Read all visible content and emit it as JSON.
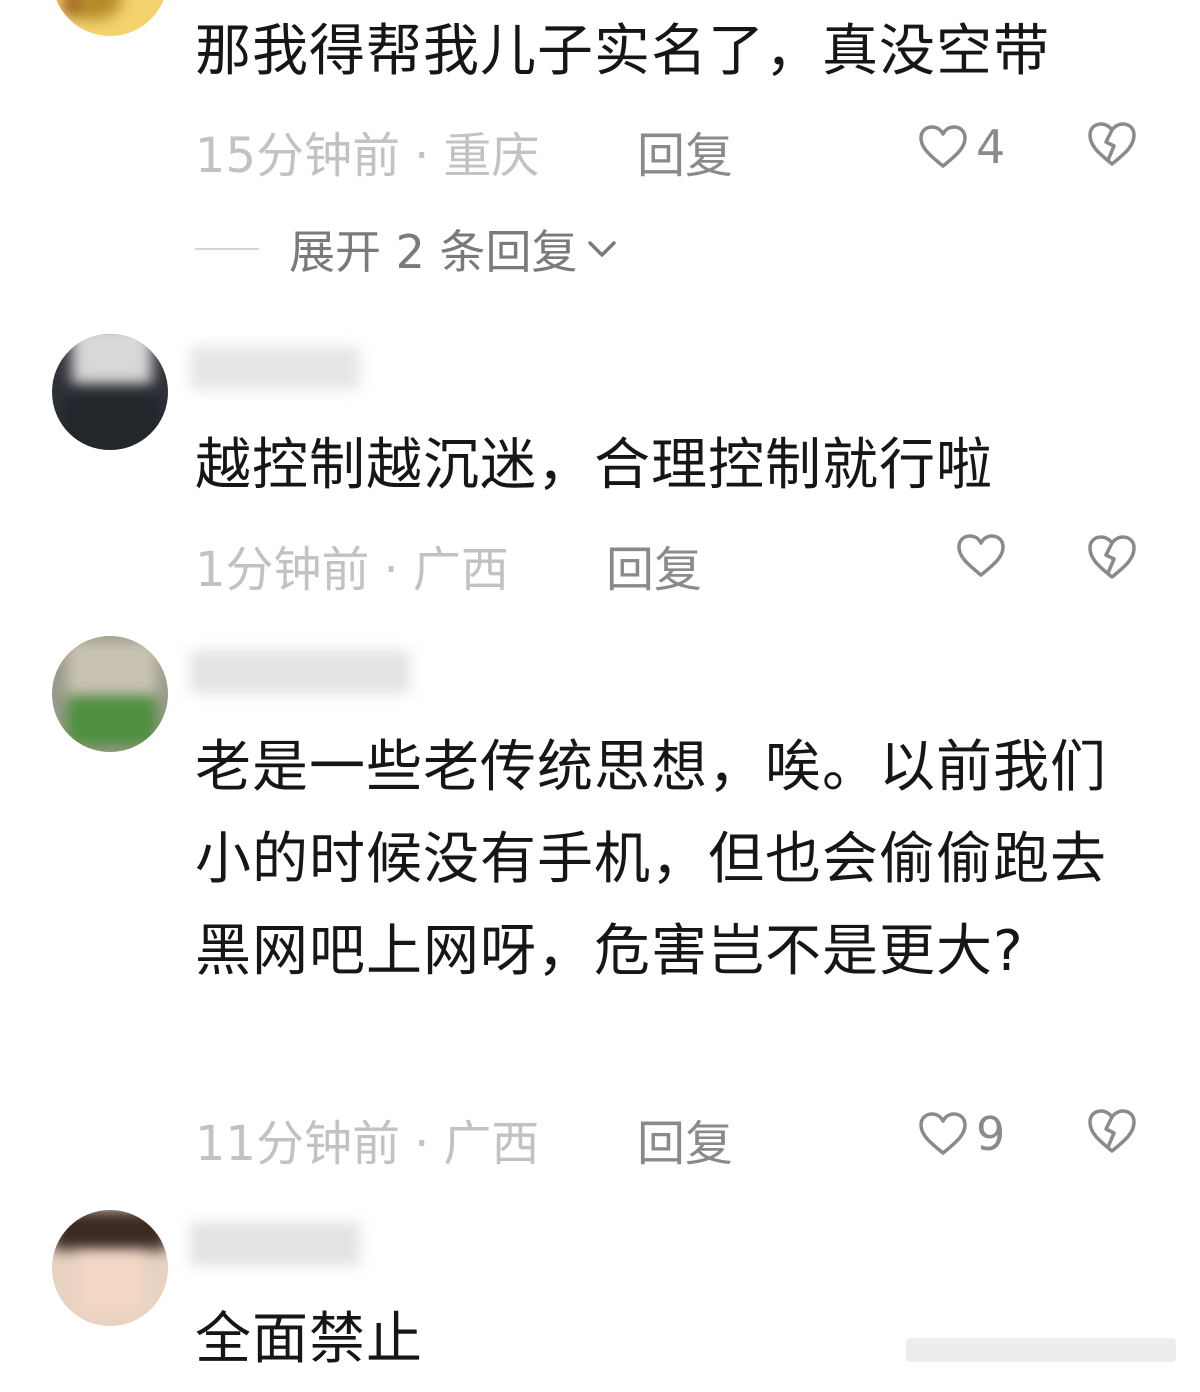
{
  "comments": [
    {
      "text": "那我得帮我儿子实名了，真没空带",
      "time": "15分钟前",
      "location": "重庆",
      "reply_label": "回复",
      "likes": "4",
      "expand": {
        "label": "展开 2 条回复"
      }
    },
    {
      "text": "越控制越沉迷，合理控制就行啦",
      "time": "1分钟前",
      "location": "广西",
      "reply_label": "回复",
      "likes": ""
    },
    {
      "text": "老是一些老传统思想，唉。以前我们小的时候没有手机，但也会偷偷跑去黑网吧上网呀，危害岂不是更大?",
      "time": "11分钟前",
      "location": "广西",
      "reply_label": "回复",
      "likes": "9"
    },
    {
      "text": "全面禁止"
    }
  ],
  "meta_separator": "·",
  "colors": {
    "text": "#161616",
    "meta": "#c2c2c2",
    "action": "#8a8a8a",
    "background": "#ffffff"
  },
  "icons": {
    "like": "heart-outline-icon",
    "dislike": "broken-heart-icon",
    "expand": "chevron-down-icon"
  }
}
